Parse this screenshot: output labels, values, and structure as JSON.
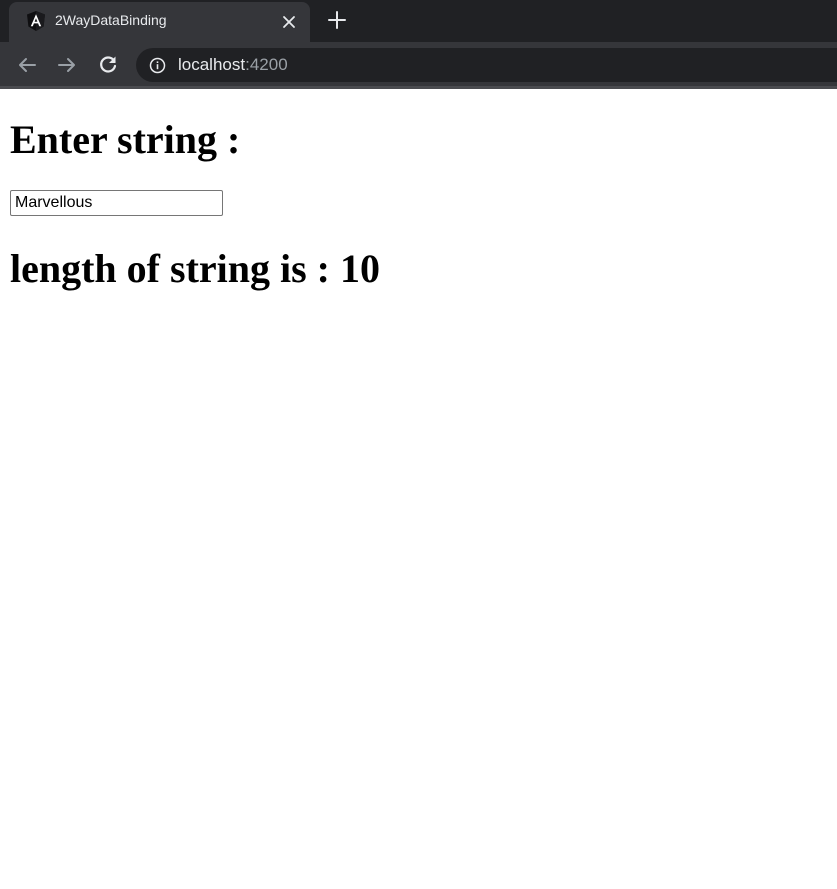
{
  "browser": {
    "tab": {
      "title": "2WayDataBinding",
      "favicon": "angular-logo-icon"
    },
    "address_bar": {
      "host": "localhost",
      "port": ":4200"
    },
    "colors": {
      "tabstrip": "#202124",
      "toolbar": "#35363a",
      "omnibox": "#202124",
      "text_light": "#e8eaed",
      "text_dim": "#9aa0a6"
    }
  },
  "page": {
    "heading": "Enter string :",
    "input": {
      "value": "Marvellous",
      "placeholder": ""
    },
    "result": {
      "label": "length of string is : ",
      "length": "10"
    }
  }
}
